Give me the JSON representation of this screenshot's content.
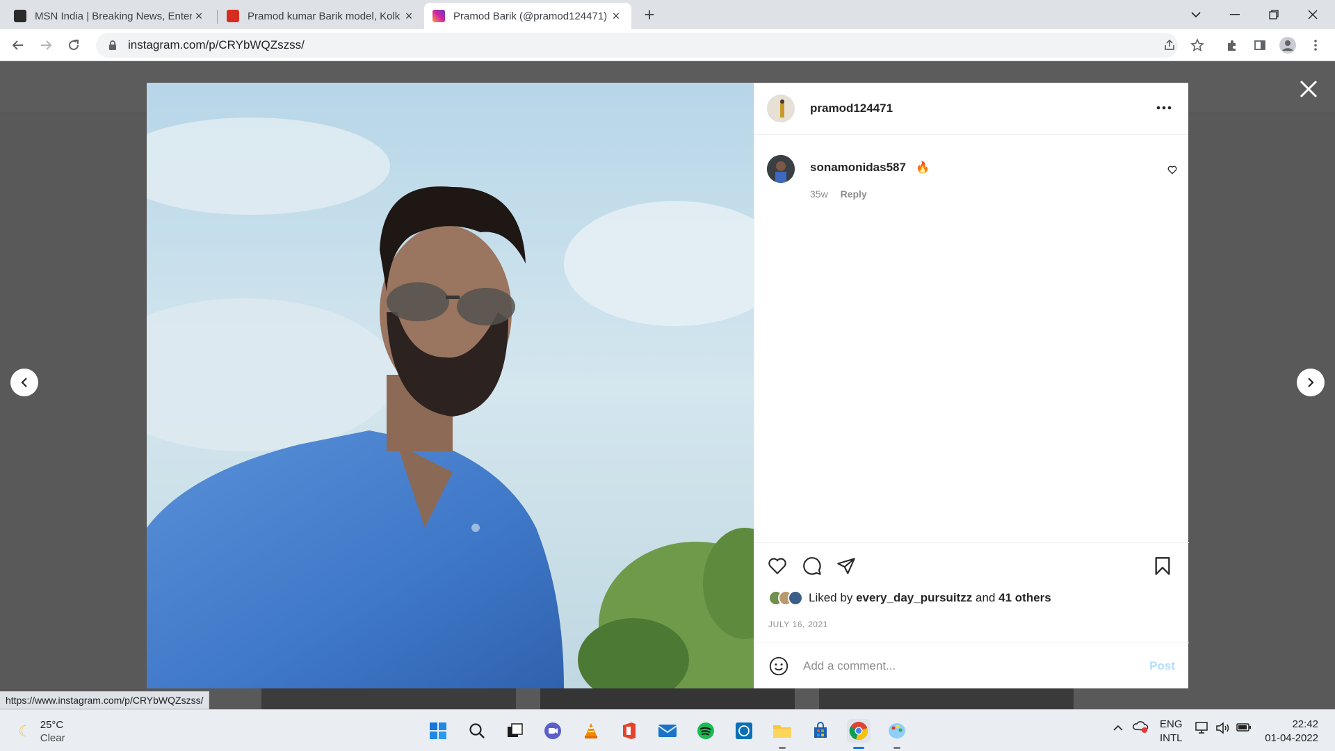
{
  "browser": {
    "tabs": [
      {
        "title": "MSN India | Breaking News, Enter",
        "favicon": "msn-icon",
        "color": "#333333"
      },
      {
        "title": "Pramod kumar Barik model, Kolk",
        "favicon": "site-icon",
        "color": "#d62d20"
      },
      {
        "title": "Pramod Barik (@pramod124471)",
        "favicon": "instagram-icon",
        "color": "#c13584"
      }
    ],
    "url": "instagram.com/p/CRYbWQZszss/",
    "status_url": "https://www.instagram.com/p/CRYbWQZszss/"
  },
  "post": {
    "owner": "pramod124471",
    "comment": {
      "user": "sonamonidas587",
      "emoji": "🔥",
      "age": "35w",
      "reply_label": "Reply"
    },
    "likes": {
      "prefix": "Liked by",
      "user": "every_day_pursuitzz",
      "conj": "and",
      "others": "41 others"
    },
    "date": "JULY 16, 2021",
    "add_comment_placeholder": "Add a comment...",
    "post_label": "Post"
  },
  "taskbar": {
    "weather_temp": "25°C",
    "weather_desc": "Clear",
    "lang_top": "ENG",
    "lang_bottom": "INTL",
    "time": "22:42",
    "date": "01-04-2022"
  },
  "colors": {
    "instagram_link": "#b2dffc",
    "text": "#262626",
    "muted": "#8e8e8e"
  }
}
